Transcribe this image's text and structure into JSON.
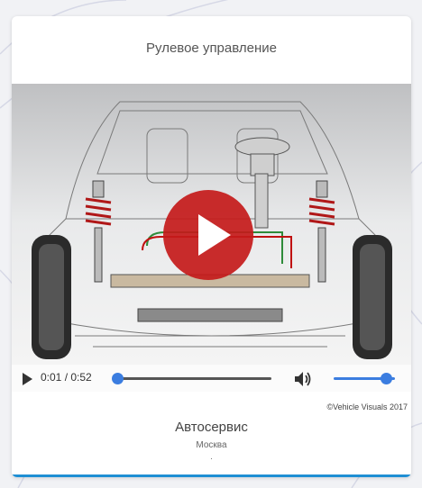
{
  "header": {
    "title": "Рулевое управление"
  },
  "video": {
    "current_time": "0:01",
    "duration": "0:52",
    "time_display": "0:01 / 0:52",
    "progress_fraction": 0.02,
    "volume_fraction": 0.85,
    "play_icon": "play-icon",
    "volume_icon": "speaker-icon",
    "accent_color": "#3b7de0",
    "play_overlay_color": "#c41a1a"
  },
  "footer": {
    "copyright": "©Vehicle Visuals 2017",
    "company": "Автосервис",
    "city": "Москва",
    "extra": "."
  },
  "theme": {
    "card_bottom_border": "#1f8fd4"
  }
}
